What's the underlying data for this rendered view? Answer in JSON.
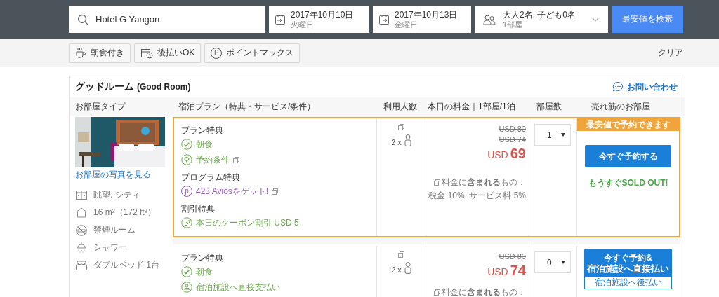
{
  "search": {
    "destination": "Hotel G Yangon",
    "checkin": {
      "date": "2017年10月10日",
      "weekday": "火曜日"
    },
    "checkout": {
      "date": "2017年10月13日",
      "weekday": "金曜日"
    },
    "guests": {
      "people": "大人2名, 子ども0名",
      "rooms": "1部屋"
    },
    "button": "最安値を検索"
  },
  "filters": [
    {
      "kind": "breakfast",
      "label": "朝食付き"
    },
    {
      "kind": "paylater",
      "label": "後払いOK"
    },
    {
      "kind": "points",
      "icon": "P",
      "label": "ポイントマックス"
    }
  ],
  "clear": "クリア",
  "room": {
    "title": "グッドルーム",
    "title_en": "(Good Room)",
    "contact": "お問い合わせ",
    "columns": [
      "お部屋タイプ",
      "宿泊プラン（特典・サービス/条件）",
      "利用人数",
      "本日の料金｜1部屋/1泊",
      "部屋数",
      "売れ筋のお部屋"
    ],
    "photo_link": "お部屋の写真を見る",
    "features": [
      {
        "kind": "view",
        "label": "眺望: シティ"
      },
      {
        "kind": "size",
        "label": "16 m²（172 ft²）"
      },
      {
        "kind": "nosmoking",
        "label": "禁煙ルーム"
      },
      {
        "kind": "shower",
        "label": "シャワー"
      },
      {
        "kind": "bed",
        "label": "ダブルベッド 1台"
      }
    ],
    "plans": [
      {
        "highlighted": true,
        "banner": "最安値で予約できます",
        "groups": [
          {
            "title": "プラン特典",
            "items": [
              {
                "kind": "check",
                "label": "朝食",
                "link": false
              },
              {
                "kind": "bulb",
                "label": "予約条件",
                "link": true
              }
            ]
          },
          {
            "title": "プログラム特典",
            "items": [
              {
                "kind": "points",
                "icon": "p",
                "label": "423 Aviosをゲット!",
                "link": true
              }
            ]
          },
          {
            "title": "割引特典",
            "items": [
              {
                "kind": "tag",
                "label": "本日のクーポン割引 USD 5",
                "link": false
              }
            ]
          }
        ],
        "guests": "2 x",
        "old_prices": [
          "USD 80",
          "USD 74"
        ],
        "currency": "USD",
        "price": "69",
        "includes": "料金に**含まれる**もの：",
        "taxes": "税金 10%, サービス料 5%",
        "rooms": "1",
        "action": {
          "kind": "book",
          "label": "今すぐ予約する",
          "note": "もうすぐSOLD OUT!"
        }
      },
      {
        "highlighted": false,
        "groups": [
          {
            "title": "プラン特典",
            "items": [
              {
                "kind": "check",
                "label": "朝食",
                "link": false
              },
              {
                "kind": "payment",
                "label": "宿泊施設へ直接支払い",
                "link": false
              }
            ]
          }
        ],
        "guests": "2 x",
        "old_prices": [
          "USD 80"
        ],
        "currency": "USD",
        "price": "74",
        "includes": "料金に**含まれる**もの：",
        "rooms": "0",
        "action": {
          "kind": "pay_at_hotel",
          "line1": "今すぐ予約&",
          "line2": "宿泊施設へ直接払い",
          "sub": "宿泊施設へ後払い"
        }
      }
    ]
  }
}
